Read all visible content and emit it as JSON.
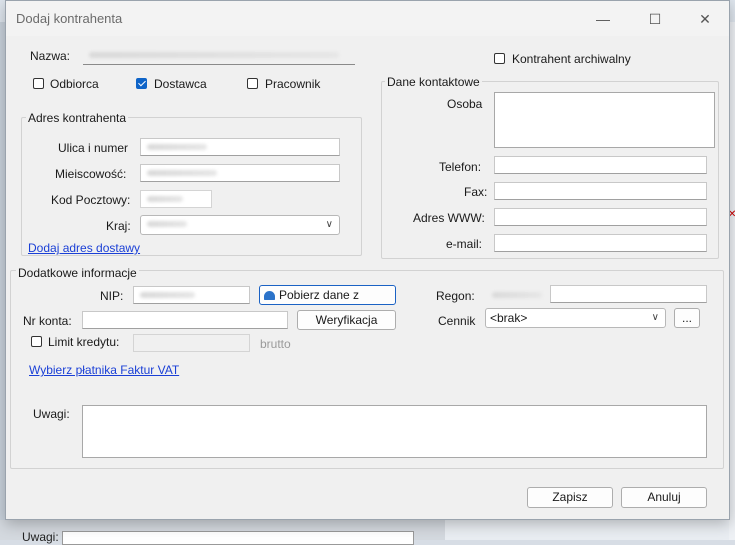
{
  "window": {
    "title": "Dodaj kontrahenta"
  },
  "fields": {
    "nazwa_label": "Nazwa:",
    "archival_label": "Kontrahent archiwalny",
    "role_odbiorca": "Odbiorca",
    "role_dostawca": "Dostawca",
    "role_pracownik": "Pracownik"
  },
  "address": {
    "group_title": "Adres kontrahenta",
    "street_label": "Ulica i numer",
    "city_label": "Mieiscowość:",
    "postal_label": "Kod Pocztowy:",
    "country_label": "Kraj:",
    "add_delivery_link": "Dodaj adres dostawy"
  },
  "contact": {
    "group_title": "Dane kontaktowe",
    "person_label": "Osoba",
    "phone_label": "Telefon:",
    "fax_label": "Fax:",
    "www_label": "Adres WWW:",
    "email_label": "e-mail:"
  },
  "extra": {
    "group_title": "Dodatkowe informacje",
    "nip_label": "NIP:",
    "fetch_button": "Pobierz dane z",
    "regon_label": "Regon:",
    "account_label": "Nr konta:",
    "verify_button": "Weryfikacja",
    "pricelist_label": "Cennik",
    "pricelist_value": "<brak>",
    "more_button": "...",
    "credit_label": "Limit kredytu:",
    "gross_label": "brutto",
    "vat_payer_link": "Wybierz płatnika Faktur VAT",
    "notes_label": "Uwagi:"
  },
  "footer": {
    "save_button": "Zapisz",
    "cancel_button": "Anuluj"
  },
  "background": {
    "notes_label": "Uwagi:"
  }
}
